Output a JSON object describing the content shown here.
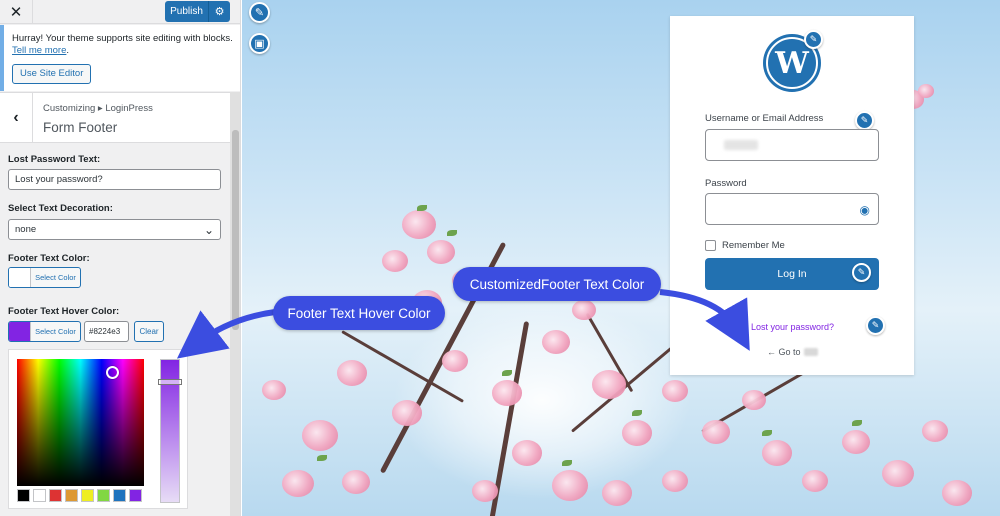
{
  "sidebar": {
    "close_glyph": "✕",
    "publish_label": "Publish",
    "settings_glyph": "⚙",
    "notice": {
      "text": "Hurray! Your theme supports site editing with blocks.",
      "link": "Tell me more",
      "link_suffix": ".",
      "button": "Use Site Editor"
    },
    "back_glyph": "‹",
    "breadcrumb": "Customizing ▸ LoginPress",
    "section_title": "Form Footer",
    "lost_password_label": "Lost Password Text:",
    "lost_password_value": "Lost your password?",
    "decoration_label": "Select Text Decoration:",
    "decoration_value": "none",
    "select_chevron": "⌄",
    "footer_color_label": "Footer Text Color:",
    "footer_color_button": "Select Color",
    "footer_color_swatch": "#ffffff",
    "hover_color_label": "Footer Text Hover Color:",
    "hover_color_button": "Select Color",
    "hover_color_swatch": "#8224e3",
    "hover_hex": "#8224e3",
    "clear_label": "Clear",
    "palette": [
      "#000000",
      "#ffffff",
      "#dd3333",
      "#dd9933",
      "#eeee22",
      "#81d742",
      "#1e73be",
      "#8224e3"
    ]
  },
  "preview": {
    "login": {
      "username_label": "Username or Email Address",
      "password_label": "Password",
      "remember_label": "Remember Me",
      "login_button": "Log In",
      "lost_link": "Lost your password?",
      "goto_prefix": "← Go to"
    }
  },
  "callouts": {
    "hover": "Footer Text Hover Color",
    "footer": "CustomizedFooter Text Color"
  },
  "colors": {
    "accent": "#2271b1",
    "callout": "#3b4de0",
    "hover": "#8224e3"
  }
}
